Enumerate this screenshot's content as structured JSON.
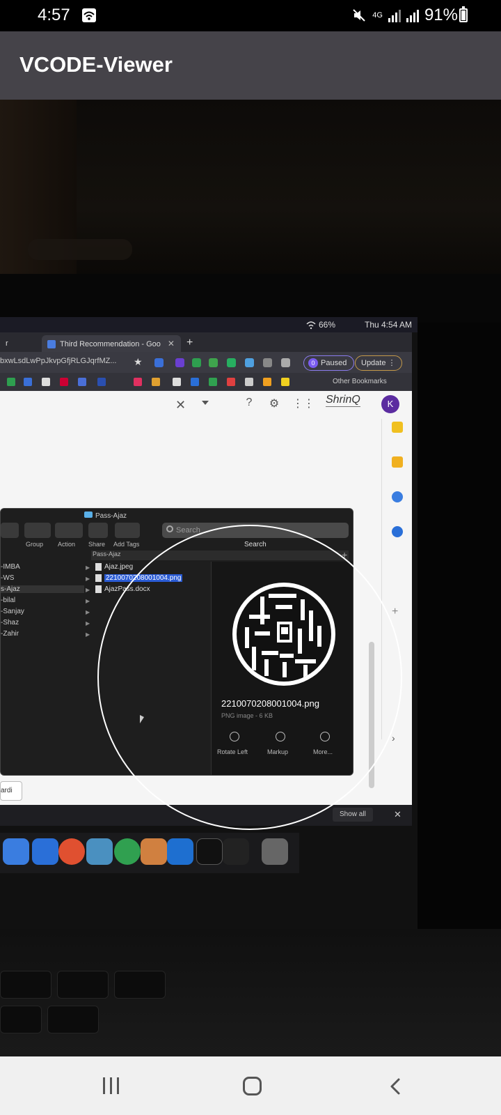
{
  "status_bar": {
    "time": "4:57",
    "network": "4G",
    "battery": "91%",
    "icons": [
      "gallery-icon",
      "mute-icon",
      "signal-icon",
      "battery-icon"
    ]
  },
  "app_bar": {
    "title": "VCODE-Viewer"
  },
  "camera_preview": {
    "mac_menubar": {
      "battery": "66%",
      "time": "Thu 4:54 AM"
    },
    "browser": {
      "tabs": [
        {
          "label": "r POC"
        },
        {
          "label": "Third Recommendation - Goo"
        }
      ],
      "url_fragment": "bxwLsdLwPpJkvpGfjRLGJqrfMZ...",
      "paused_label": "Paused",
      "paused_initial": "0",
      "update_label": "Update",
      "other_bookmarks": "Other Bookmarks",
      "brand": "ShrinQ",
      "avatar_initial": "K",
      "bottom_chip": "ardi"
    },
    "finder": {
      "title": "Pass-Ajaz",
      "toolbar_labels": [
        "Group",
        "Action",
        "Share",
        "Add Tags"
      ],
      "search_placeholder": "Search",
      "search_label": "Search",
      "path": "Pass-Ajaz",
      "sidebar_items": [
        "-IMBA",
        "-WS",
        "s-Ajaz",
        "-bilal",
        "-Sanjay",
        "-Shaz",
        "-Zahir"
      ],
      "files": [
        {
          "name": "Ajaz.jpeg",
          "selected": false
        },
        {
          "name": "2210070208001004.png",
          "selected": true
        },
        {
          "name": "AjazPass.docx",
          "selected": false
        }
      ],
      "preview_filename": "2210070208001004.png",
      "preview_type": "PNG image - 6 KB",
      "actions": [
        "Rotate Left",
        "Markup",
        "More..."
      ]
    },
    "downloads": {
      "show_all": "Show all"
    }
  },
  "colors": {
    "app_bar": "#454349",
    "status_bar": "#000000",
    "nav_bar": "#f0f0f0",
    "scan_ring": "#ffffff"
  }
}
